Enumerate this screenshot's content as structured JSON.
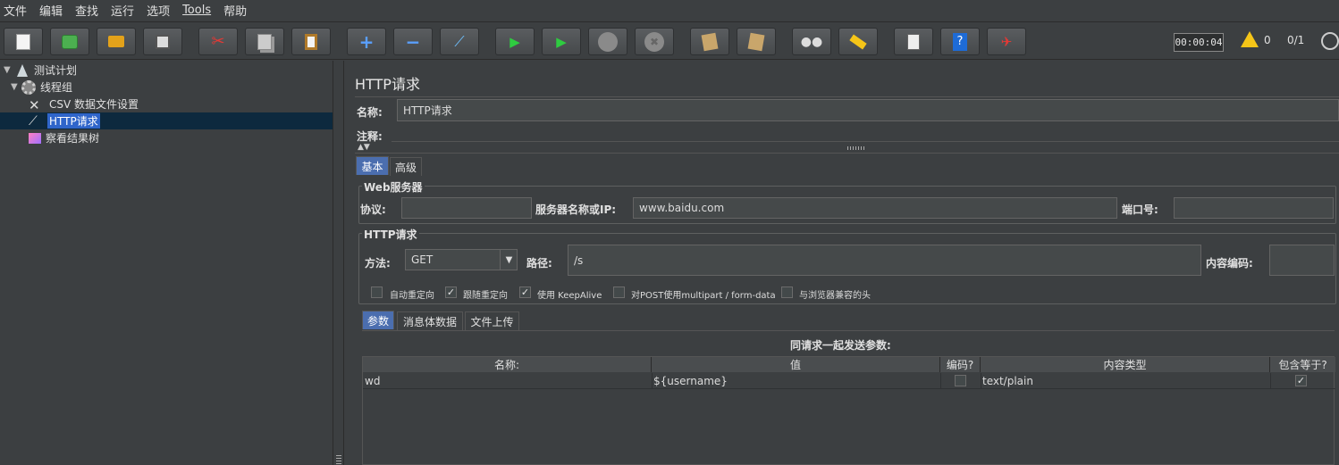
{
  "menu": [
    "文件",
    "编辑",
    "查找",
    "运行",
    "选项",
    "Tools",
    "帮助"
  ],
  "toolbar": {
    "buttons": [
      {
        "name": "new-icon",
        "glyph": "📄"
      },
      {
        "name": "templates-icon",
        "glyph": "📚"
      },
      {
        "name": "open-icon",
        "glyph": "📂"
      },
      {
        "name": "save-icon",
        "glyph": "💾"
      },
      {
        "name": "cut-icon",
        "glyph": "✂"
      },
      {
        "name": "copy-icon",
        "glyph": "⧉"
      },
      {
        "name": "paste-icon",
        "glyph": "📋"
      },
      {
        "name": "expand-icon",
        "glyph": "+"
      },
      {
        "name": "collapse-icon",
        "glyph": "−"
      },
      {
        "name": "toggle-icon",
        "glyph": "⟋"
      },
      {
        "name": "start-icon",
        "glyph": "▶"
      },
      {
        "name": "start-no-pause-icon",
        "glyph": "▶"
      },
      {
        "name": "stop-icon",
        "glyph": "⬤"
      },
      {
        "name": "shutdown-icon",
        "glyph": "✖"
      },
      {
        "name": "clear-icon",
        "glyph": "🧹"
      },
      {
        "name": "clear-all-icon",
        "glyph": "🧹"
      },
      {
        "name": "search-icon",
        "glyph": "🔭"
      },
      {
        "name": "reset-search-icon",
        "glyph": "🧽"
      },
      {
        "name": "function-helper-icon",
        "glyph": "☰"
      },
      {
        "name": "help-icon",
        "glyph": "?"
      },
      {
        "name": "remote-icon",
        "glyph": "✈"
      }
    ],
    "timer": "00:00:04",
    "warning_count": "0",
    "thread_count": "0/1"
  },
  "tree": {
    "items": [
      {
        "label": "测试计划"
      },
      {
        "label": "线程组"
      },
      {
        "label": "CSV 数据文件设置"
      },
      {
        "label": "HTTP请求"
      },
      {
        "label": "察看结果树"
      }
    ]
  },
  "panel": {
    "title": "HTTP请求",
    "name_label": "名称:",
    "name_value": "HTTP请求",
    "comment_label": "注释:",
    "tabs": [
      "基本",
      "高级"
    ],
    "web_server": {
      "legend": "Web服务器",
      "protocol_label": "协议:",
      "protocol_value": "",
      "server_label": "服务器名称或IP:",
      "server_value": "www.baidu.com",
      "port_label": "端口号:",
      "port_value": ""
    },
    "http_request": {
      "legend": "HTTP请求",
      "method_label": "方法:",
      "method_value": "GET",
      "path_label": "路径:",
      "path_value": "/s",
      "encoding_label": "内容编码:",
      "encoding_value": ""
    },
    "options": [
      {
        "label": "自动重定向",
        "checked": false
      },
      {
        "label": "跟随重定向",
        "checked": true
      },
      {
        "label": "使用 KeepAlive",
        "checked": true
      },
      {
        "label": "对POST使用multipart / form-data",
        "checked": false
      },
      {
        "label": "与浏览器兼容的头",
        "checked": false
      }
    ],
    "sub_tabs": [
      "参数",
      "消息体数据",
      "文件上传"
    ],
    "params_title": "同请求一起发送参数:",
    "columns": [
      "名称:",
      "值",
      "编码?",
      "内容类型",
      "包含等于?"
    ],
    "rows": [
      {
        "name": "wd",
        "value": "${username}",
        "encode": false,
        "content_type": "text/plain",
        "include_equals": true
      }
    ]
  }
}
